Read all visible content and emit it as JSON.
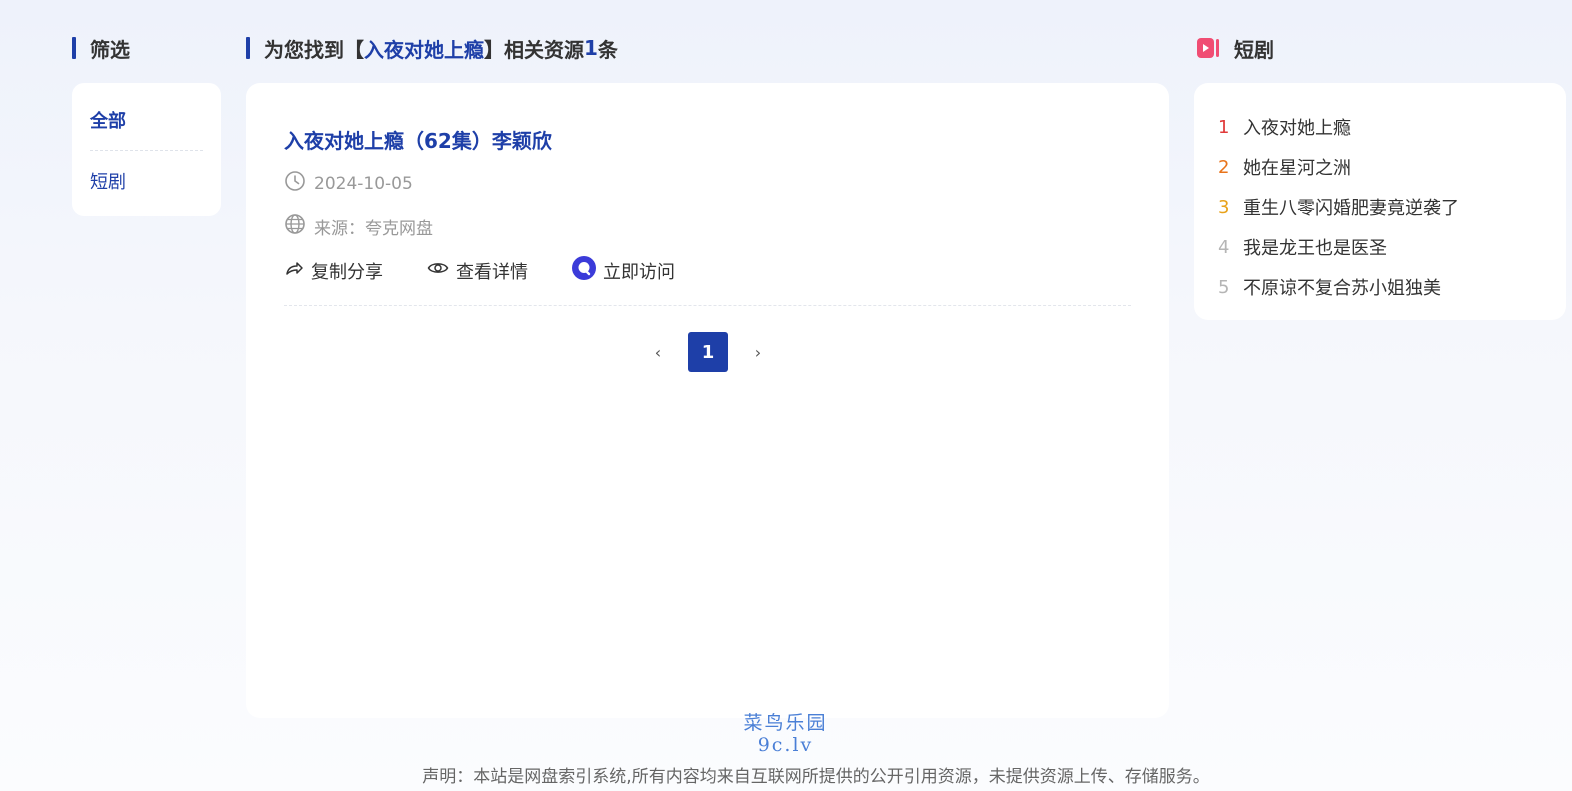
{
  "filter": {
    "title": "筛选",
    "items": [
      {
        "label": "全部",
        "active": true
      },
      {
        "label": "短剧",
        "active": false
      }
    ]
  },
  "results": {
    "title_prefix": "为您找到【",
    "keyword": "入夜对她上瘾",
    "title_mid": "】相关资源 ",
    "count": "1",
    "title_suffix": " 条",
    "items": [
      {
        "title": "入夜对她上瘾（62集）李颖欣",
        "date": "2024-10-05",
        "source": "来源：夸克网盘",
        "actions": {
          "share": "复制分享",
          "detail": "查看详情",
          "visit": "立即访问"
        }
      }
    ],
    "pagination": {
      "current": "1",
      "prev": "‹",
      "next": "›"
    }
  },
  "drama": {
    "title": "短剧",
    "items": [
      {
        "rank": "1",
        "label": "入夜对她上瘾",
        "color": "#e03a3a"
      },
      {
        "rank": "2",
        "label": "她在星河之洲",
        "color": "#e8731a"
      },
      {
        "rank": "3",
        "label": "重生八零闪婚肥妻竟逆袭了",
        "color": "#e8a21a"
      },
      {
        "rank": "4",
        "label": "我是龙王也是医圣",
        "color": "#b5b5b5"
      },
      {
        "rank": "5",
        "label": "不原谅不复合苏小姐独美",
        "color": "#b5b5b5"
      }
    ]
  },
  "watermark": {
    "line1": "菜鸟乐园",
    "line2": "9c.lv"
  },
  "footer": {
    "text": "声明：本站是网盘索引系统,所有内容均来自互联网所提供的公开引用资源，未提供资源上传、存储服务。"
  },
  "colors": {
    "accent": "#1e3fa8",
    "drama_icon": "#f04d73"
  }
}
